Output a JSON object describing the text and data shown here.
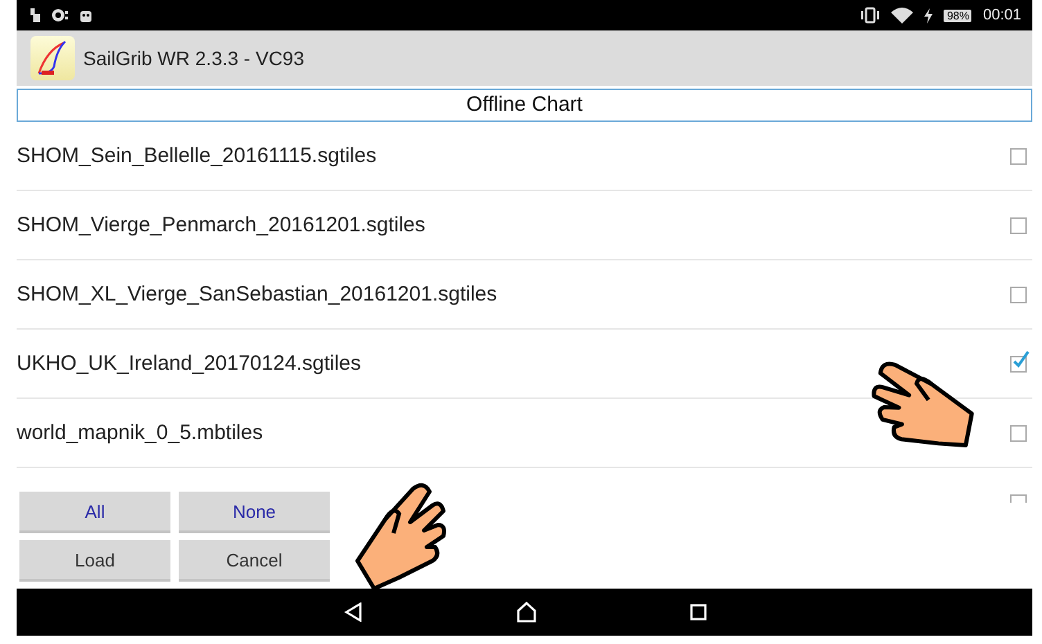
{
  "status_bar": {
    "battery": "98%",
    "time": "00:01"
  },
  "app_bar": {
    "title": "SailGrib WR 2.3.3 - VC93"
  },
  "dialog": {
    "title": "Offline Chart",
    "items": [
      {
        "label": "SHOM_Sein_Bellelle_20161115.sgtiles",
        "checked": false
      },
      {
        "label": "SHOM_Vierge_Penmarch_20161201.sgtiles",
        "checked": false
      },
      {
        "label": "SHOM_XL_Vierge_SanSebastian_20161201.sgtiles",
        "checked": false
      },
      {
        "label": "UKHO_UK_Ireland_20170124.sgtiles",
        "checked": true
      },
      {
        "label": "world_mapnik_0_5.mbtiles",
        "checked": false
      },
      {
        "checked": false
      }
    ],
    "buttons": [
      {
        "label": "All",
        "kind": "select"
      },
      {
        "label": "None",
        "kind": "select"
      },
      {
        "label": "Load",
        "kind": "action"
      },
      {
        "label": "Cancel",
        "kind": "action"
      }
    ]
  }
}
